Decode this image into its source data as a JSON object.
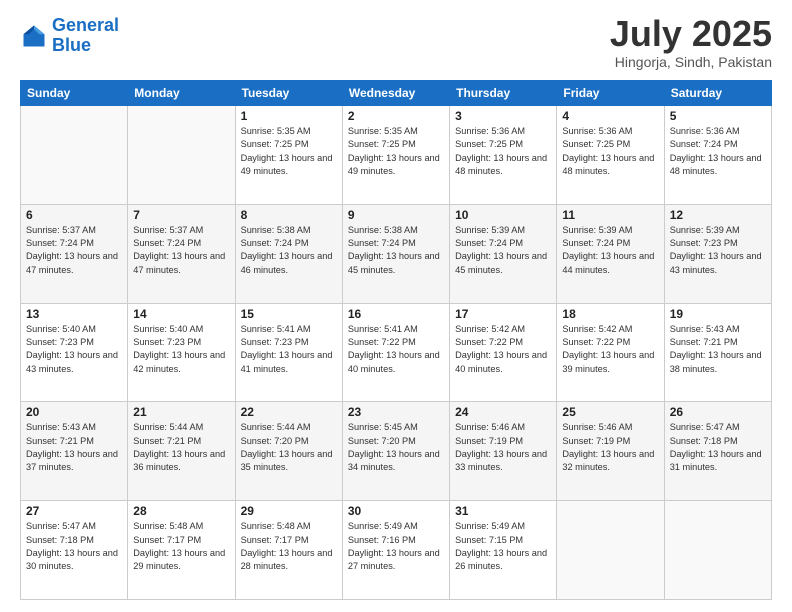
{
  "header": {
    "logo_line1": "General",
    "logo_line2": "Blue",
    "title": "July 2025",
    "subtitle": "Hingorja, Sindh, Pakistan"
  },
  "weekdays": [
    "Sunday",
    "Monday",
    "Tuesday",
    "Wednesday",
    "Thursday",
    "Friday",
    "Saturday"
  ],
  "weeks": [
    [
      {
        "day": "",
        "info": ""
      },
      {
        "day": "",
        "info": ""
      },
      {
        "day": "1",
        "info": "Sunrise: 5:35 AM\nSunset: 7:25 PM\nDaylight: 13 hours and 49 minutes."
      },
      {
        "day": "2",
        "info": "Sunrise: 5:35 AM\nSunset: 7:25 PM\nDaylight: 13 hours and 49 minutes."
      },
      {
        "day": "3",
        "info": "Sunrise: 5:36 AM\nSunset: 7:25 PM\nDaylight: 13 hours and 48 minutes."
      },
      {
        "day": "4",
        "info": "Sunrise: 5:36 AM\nSunset: 7:25 PM\nDaylight: 13 hours and 48 minutes."
      },
      {
        "day": "5",
        "info": "Sunrise: 5:36 AM\nSunset: 7:24 PM\nDaylight: 13 hours and 48 minutes."
      }
    ],
    [
      {
        "day": "6",
        "info": "Sunrise: 5:37 AM\nSunset: 7:24 PM\nDaylight: 13 hours and 47 minutes."
      },
      {
        "day": "7",
        "info": "Sunrise: 5:37 AM\nSunset: 7:24 PM\nDaylight: 13 hours and 47 minutes."
      },
      {
        "day": "8",
        "info": "Sunrise: 5:38 AM\nSunset: 7:24 PM\nDaylight: 13 hours and 46 minutes."
      },
      {
        "day": "9",
        "info": "Sunrise: 5:38 AM\nSunset: 7:24 PM\nDaylight: 13 hours and 45 minutes."
      },
      {
        "day": "10",
        "info": "Sunrise: 5:39 AM\nSunset: 7:24 PM\nDaylight: 13 hours and 45 minutes."
      },
      {
        "day": "11",
        "info": "Sunrise: 5:39 AM\nSunset: 7:24 PM\nDaylight: 13 hours and 44 minutes."
      },
      {
        "day": "12",
        "info": "Sunrise: 5:39 AM\nSunset: 7:23 PM\nDaylight: 13 hours and 43 minutes."
      }
    ],
    [
      {
        "day": "13",
        "info": "Sunrise: 5:40 AM\nSunset: 7:23 PM\nDaylight: 13 hours and 43 minutes."
      },
      {
        "day": "14",
        "info": "Sunrise: 5:40 AM\nSunset: 7:23 PM\nDaylight: 13 hours and 42 minutes."
      },
      {
        "day": "15",
        "info": "Sunrise: 5:41 AM\nSunset: 7:23 PM\nDaylight: 13 hours and 41 minutes."
      },
      {
        "day": "16",
        "info": "Sunrise: 5:41 AM\nSunset: 7:22 PM\nDaylight: 13 hours and 40 minutes."
      },
      {
        "day": "17",
        "info": "Sunrise: 5:42 AM\nSunset: 7:22 PM\nDaylight: 13 hours and 40 minutes."
      },
      {
        "day": "18",
        "info": "Sunrise: 5:42 AM\nSunset: 7:22 PM\nDaylight: 13 hours and 39 minutes."
      },
      {
        "day": "19",
        "info": "Sunrise: 5:43 AM\nSunset: 7:21 PM\nDaylight: 13 hours and 38 minutes."
      }
    ],
    [
      {
        "day": "20",
        "info": "Sunrise: 5:43 AM\nSunset: 7:21 PM\nDaylight: 13 hours and 37 minutes."
      },
      {
        "day": "21",
        "info": "Sunrise: 5:44 AM\nSunset: 7:21 PM\nDaylight: 13 hours and 36 minutes."
      },
      {
        "day": "22",
        "info": "Sunrise: 5:44 AM\nSunset: 7:20 PM\nDaylight: 13 hours and 35 minutes."
      },
      {
        "day": "23",
        "info": "Sunrise: 5:45 AM\nSunset: 7:20 PM\nDaylight: 13 hours and 34 minutes."
      },
      {
        "day": "24",
        "info": "Sunrise: 5:46 AM\nSunset: 7:19 PM\nDaylight: 13 hours and 33 minutes."
      },
      {
        "day": "25",
        "info": "Sunrise: 5:46 AM\nSunset: 7:19 PM\nDaylight: 13 hours and 32 minutes."
      },
      {
        "day": "26",
        "info": "Sunrise: 5:47 AM\nSunset: 7:18 PM\nDaylight: 13 hours and 31 minutes."
      }
    ],
    [
      {
        "day": "27",
        "info": "Sunrise: 5:47 AM\nSunset: 7:18 PM\nDaylight: 13 hours and 30 minutes."
      },
      {
        "day": "28",
        "info": "Sunrise: 5:48 AM\nSunset: 7:17 PM\nDaylight: 13 hours and 29 minutes."
      },
      {
        "day": "29",
        "info": "Sunrise: 5:48 AM\nSunset: 7:17 PM\nDaylight: 13 hours and 28 minutes."
      },
      {
        "day": "30",
        "info": "Sunrise: 5:49 AM\nSunset: 7:16 PM\nDaylight: 13 hours and 27 minutes."
      },
      {
        "day": "31",
        "info": "Sunrise: 5:49 AM\nSunset: 7:15 PM\nDaylight: 13 hours and 26 minutes."
      },
      {
        "day": "",
        "info": ""
      },
      {
        "day": "",
        "info": ""
      }
    ]
  ]
}
